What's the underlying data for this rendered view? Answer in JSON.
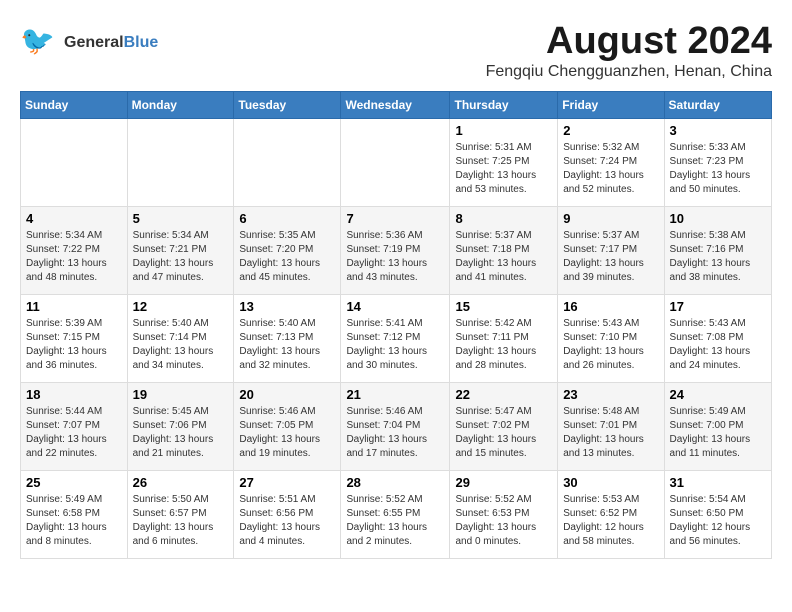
{
  "header": {
    "logo_general": "General",
    "logo_blue": "Blue",
    "month_year": "August 2024",
    "location": "Fengqiu Chengguanzhen, Henan, China"
  },
  "weekdays": [
    "Sunday",
    "Monday",
    "Tuesday",
    "Wednesday",
    "Thursday",
    "Friday",
    "Saturday"
  ],
  "weeks": [
    [
      {
        "day": "",
        "info": ""
      },
      {
        "day": "",
        "info": ""
      },
      {
        "day": "",
        "info": ""
      },
      {
        "day": "",
        "info": ""
      },
      {
        "day": "1",
        "info": "Sunrise: 5:31 AM\nSunset: 7:25 PM\nDaylight: 13 hours\nand 53 minutes."
      },
      {
        "day": "2",
        "info": "Sunrise: 5:32 AM\nSunset: 7:24 PM\nDaylight: 13 hours\nand 52 minutes."
      },
      {
        "day": "3",
        "info": "Sunrise: 5:33 AM\nSunset: 7:23 PM\nDaylight: 13 hours\nand 50 minutes."
      }
    ],
    [
      {
        "day": "4",
        "info": "Sunrise: 5:34 AM\nSunset: 7:22 PM\nDaylight: 13 hours\nand 48 minutes."
      },
      {
        "day": "5",
        "info": "Sunrise: 5:34 AM\nSunset: 7:21 PM\nDaylight: 13 hours\nand 47 minutes."
      },
      {
        "day": "6",
        "info": "Sunrise: 5:35 AM\nSunset: 7:20 PM\nDaylight: 13 hours\nand 45 minutes."
      },
      {
        "day": "7",
        "info": "Sunrise: 5:36 AM\nSunset: 7:19 PM\nDaylight: 13 hours\nand 43 minutes."
      },
      {
        "day": "8",
        "info": "Sunrise: 5:37 AM\nSunset: 7:18 PM\nDaylight: 13 hours\nand 41 minutes."
      },
      {
        "day": "9",
        "info": "Sunrise: 5:37 AM\nSunset: 7:17 PM\nDaylight: 13 hours\nand 39 minutes."
      },
      {
        "day": "10",
        "info": "Sunrise: 5:38 AM\nSunset: 7:16 PM\nDaylight: 13 hours\nand 38 minutes."
      }
    ],
    [
      {
        "day": "11",
        "info": "Sunrise: 5:39 AM\nSunset: 7:15 PM\nDaylight: 13 hours\nand 36 minutes."
      },
      {
        "day": "12",
        "info": "Sunrise: 5:40 AM\nSunset: 7:14 PM\nDaylight: 13 hours\nand 34 minutes."
      },
      {
        "day": "13",
        "info": "Sunrise: 5:40 AM\nSunset: 7:13 PM\nDaylight: 13 hours\nand 32 minutes."
      },
      {
        "day": "14",
        "info": "Sunrise: 5:41 AM\nSunset: 7:12 PM\nDaylight: 13 hours\nand 30 minutes."
      },
      {
        "day": "15",
        "info": "Sunrise: 5:42 AM\nSunset: 7:11 PM\nDaylight: 13 hours\nand 28 minutes."
      },
      {
        "day": "16",
        "info": "Sunrise: 5:43 AM\nSunset: 7:10 PM\nDaylight: 13 hours\nand 26 minutes."
      },
      {
        "day": "17",
        "info": "Sunrise: 5:43 AM\nSunset: 7:08 PM\nDaylight: 13 hours\nand 24 minutes."
      }
    ],
    [
      {
        "day": "18",
        "info": "Sunrise: 5:44 AM\nSunset: 7:07 PM\nDaylight: 13 hours\nand 22 minutes."
      },
      {
        "day": "19",
        "info": "Sunrise: 5:45 AM\nSunset: 7:06 PM\nDaylight: 13 hours\nand 21 minutes."
      },
      {
        "day": "20",
        "info": "Sunrise: 5:46 AM\nSunset: 7:05 PM\nDaylight: 13 hours\nand 19 minutes."
      },
      {
        "day": "21",
        "info": "Sunrise: 5:46 AM\nSunset: 7:04 PM\nDaylight: 13 hours\nand 17 minutes."
      },
      {
        "day": "22",
        "info": "Sunrise: 5:47 AM\nSunset: 7:02 PM\nDaylight: 13 hours\nand 15 minutes."
      },
      {
        "day": "23",
        "info": "Sunrise: 5:48 AM\nSunset: 7:01 PM\nDaylight: 13 hours\nand 13 minutes."
      },
      {
        "day": "24",
        "info": "Sunrise: 5:49 AM\nSunset: 7:00 PM\nDaylight: 13 hours\nand 11 minutes."
      }
    ],
    [
      {
        "day": "25",
        "info": "Sunrise: 5:49 AM\nSunset: 6:58 PM\nDaylight: 13 hours\nand 8 minutes."
      },
      {
        "day": "26",
        "info": "Sunrise: 5:50 AM\nSunset: 6:57 PM\nDaylight: 13 hours\nand 6 minutes."
      },
      {
        "day": "27",
        "info": "Sunrise: 5:51 AM\nSunset: 6:56 PM\nDaylight: 13 hours\nand 4 minutes."
      },
      {
        "day": "28",
        "info": "Sunrise: 5:52 AM\nSunset: 6:55 PM\nDaylight: 13 hours\nand 2 minutes."
      },
      {
        "day": "29",
        "info": "Sunrise: 5:52 AM\nSunset: 6:53 PM\nDaylight: 13 hours\nand 0 minutes."
      },
      {
        "day": "30",
        "info": "Sunrise: 5:53 AM\nSunset: 6:52 PM\nDaylight: 12 hours\nand 58 minutes."
      },
      {
        "day": "31",
        "info": "Sunrise: 5:54 AM\nSunset: 6:50 PM\nDaylight: 12 hours\nand 56 minutes."
      }
    ]
  ]
}
